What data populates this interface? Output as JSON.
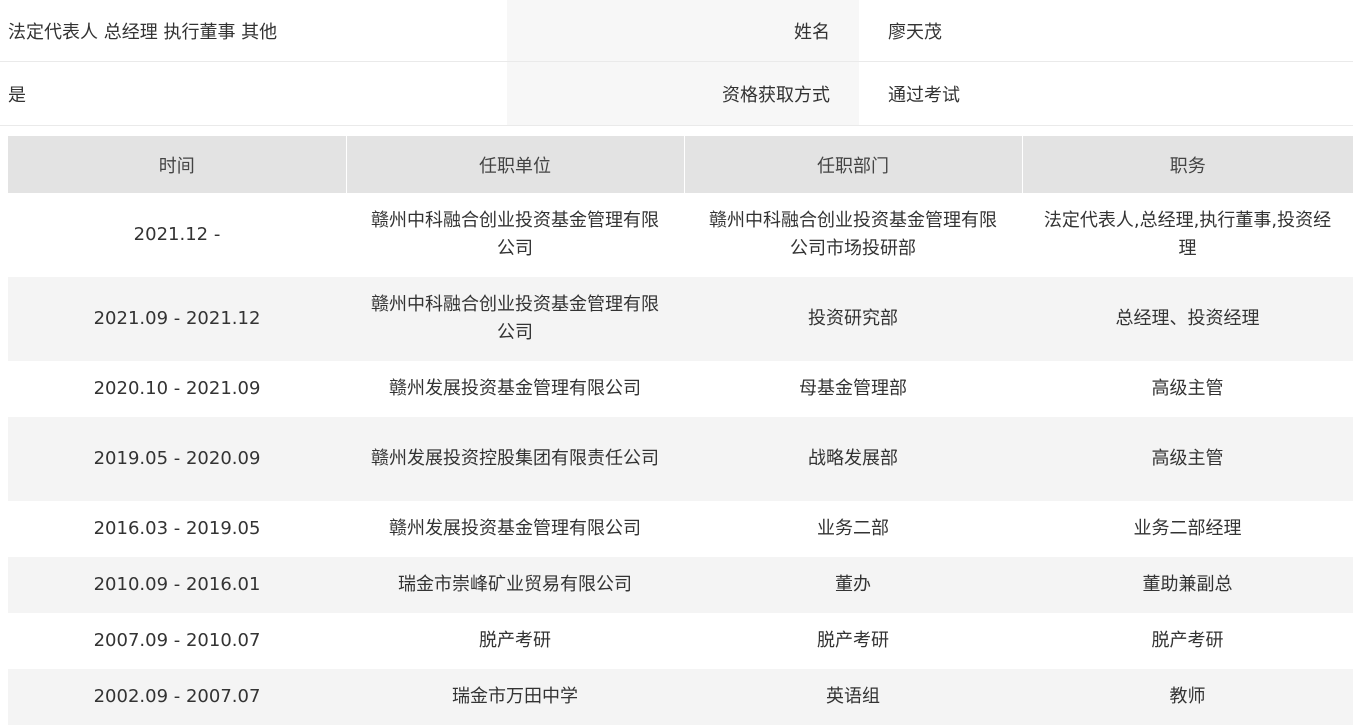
{
  "info": {
    "roles": "法定代表人 总经理 执行董事 其他",
    "name_label": "姓名",
    "name_value": "廖天茂",
    "flag": "是",
    "qualification_label": "资格获取方式",
    "qualification_value": "通过考试"
  },
  "table": {
    "headers": [
      "时间",
      "任职单位",
      "任职部门",
      "职务"
    ],
    "rows": [
      {
        "time": "2021.12 -",
        "company": "赣州中科融合创业投资基金管理有限公司",
        "department": "赣州中科融合创业投资基金管理有限公司市场投研部",
        "position": "法定代表人,总经理,执行董事,投资经理"
      },
      {
        "time": "2021.09 - 2021.12",
        "company": "赣州中科融合创业投资基金管理有限公司",
        "department": "投资研究部",
        "position": "总经理、投资经理"
      },
      {
        "time": "2020.10 - 2021.09",
        "company": "赣州发展投资基金管理有限公司",
        "department": "母基金管理部",
        "position": "高级主管"
      },
      {
        "time": "2019.05 - 2020.09",
        "company": "赣州发展投资控股集团有限责任公司",
        "department": "战略发展部",
        "position": "高级主管"
      },
      {
        "time": "2016.03 - 2019.05",
        "company": "赣州发展投资基金管理有限公司",
        "department": "业务二部",
        "position": "业务二部经理"
      },
      {
        "time": "2010.09 - 2016.01",
        "company": "瑞金市崇峰矿业贸易有限公司",
        "department": "董办",
        "position": "董助兼副总"
      },
      {
        "time": "2007.09 - 2010.07",
        "company": "脱产考研",
        "department": "脱产考研",
        "position": "脱产考研"
      },
      {
        "time": "2002.09 - 2007.07",
        "company": "瑞金市万田中学",
        "department": "英语组",
        "position": "教师"
      }
    ]
  }
}
